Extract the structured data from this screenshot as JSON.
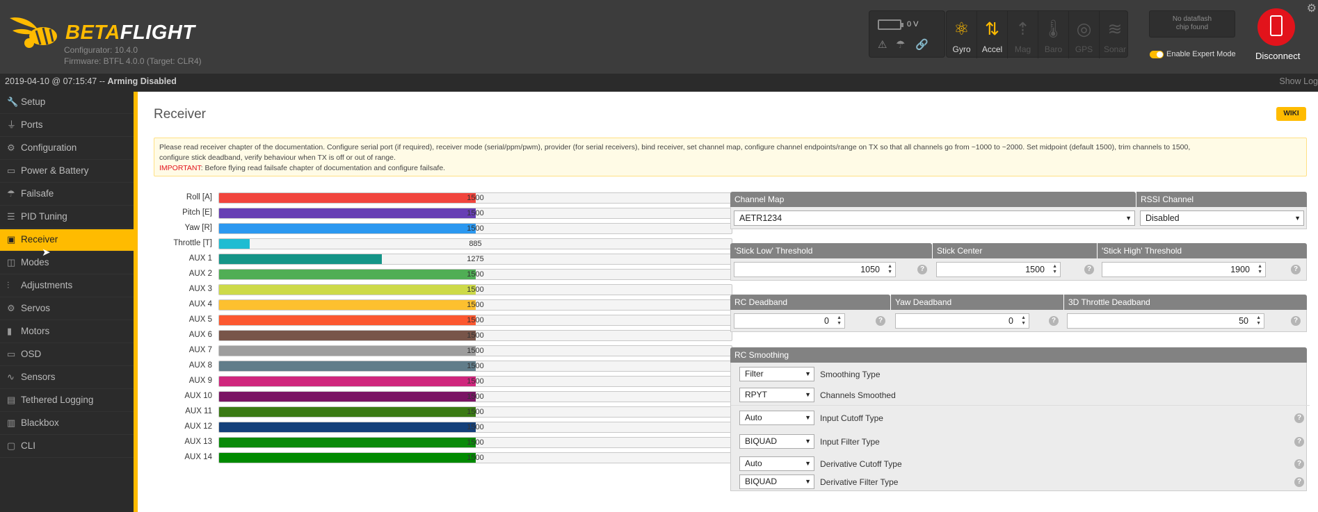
{
  "header": {
    "brand_beta": "BETA",
    "brand_flight": "FLIGHT",
    "configurator_version": "Configurator: 10.4.0",
    "firmware": "Firmware: BTFL 4.0.0 (Target: CLR4)",
    "battery_voltage": "0 V",
    "sensors": [
      {
        "label": "Gyro",
        "icon": "gyro-icon",
        "active": true
      },
      {
        "label": "Accel",
        "icon": "accel-icon",
        "active": true
      },
      {
        "label": "Mag",
        "icon": "mag-icon",
        "active": false
      },
      {
        "label": "Baro",
        "icon": "baro-icon",
        "active": false
      },
      {
        "label": "GPS",
        "icon": "gps-icon",
        "active": false
      },
      {
        "label": "Sonar",
        "icon": "sonar-icon",
        "active": false
      }
    ],
    "dataflash_line1": "No dataflash",
    "dataflash_line2": "chip found",
    "expert_mode_label": "Enable Expert Mode",
    "disconnect_label": "Disconnect"
  },
  "status_bar": {
    "datetime": "2019-04-10 @ 07:15:47 -- ",
    "arming": "Arming Disabled",
    "show_log": "Show Log"
  },
  "sidebar": {
    "items": [
      {
        "label": "Setup",
        "icon": "wrench-icon"
      },
      {
        "label": "Ports",
        "icon": "plug-icon"
      },
      {
        "label": "Configuration",
        "icon": "gear-icon"
      },
      {
        "label": "Power & Battery",
        "icon": "battery-icon"
      },
      {
        "label": "Failsafe",
        "icon": "parachute-icon"
      },
      {
        "label": "PID Tuning",
        "icon": "sliders-icon"
      },
      {
        "label": "Receiver",
        "icon": "receiver-icon",
        "active": true
      },
      {
        "label": "Modes",
        "icon": "modes-icon"
      },
      {
        "label": "Adjustments",
        "icon": "adjustments-icon"
      },
      {
        "label": "Servos",
        "icon": "servo-icon"
      },
      {
        "label": "Motors",
        "icon": "motor-icon"
      },
      {
        "label": "OSD",
        "icon": "osd-icon"
      },
      {
        "label": "Sensors",
        "icon": "sensors-icon"
      },
      {
        "label": "Tethered Logging",
        "icon": "tethered-logging-icon"
      },
      {
        "label": "Blackbox",
        "icon": "blackbox-icon"
      },
      {
        "label": "CLI",
        "icon": "cli-icon"
      }
    ]
  },
  "page": {
    "title": "Receiver",
    "wiki": "WIKI",
    "note_line1": "Please read receiver chapter of the documentation. Configure serial port (if required), receiver mode (serial/ppm/pwm), provider (for serial receivers), bind receiver, set channel map, configure channel endpoints/range on TX so that all channels go from ~1000 to ~2000. Set midpoint (default 1500), trim channels to 1500,",
    "note_line2": "configure stick deadband, verify behaviour when TX is off or out of range.",
    "note_important": "IMPORTANT",
    "note_line3": ": Before flying read failsafe chapter of documentation and configure failsafe."
  },
  "channels": {
    "range": [
      885,
      2115
    ],
    "items": [
      {
        "label": "Roll [A]",
        "value": 1500,
        "color": "#f1453d"
      },
      {
        "label": "Pitch [E]",
        "value": 1500,
        "color": "#673fb4"
      },
      {
        "label": "Yaw [R]",
        "value": 1500,
        "color": "#2b98f0"
      },
      {
        "label": "Throttle [T]",
        "value": 885,
        "color": "#1fbcd2",
        "fill_fraction": 0.06
      },
      {
        "label": "AUX 1",
        "value": 1275,
        "color": "#159588"
      },
      {
        "label": "AUX 2",
        "value": 1500,
        "color": "#50ae55"
      },
      {
        "label": "AUX 3",
        "value": 1500,
        "color": "#cdda49"
      },
      {
        "label": "AUX 4",
        "value": 1500,
        "color": "#fdc02f"
      },
      {
        "label": "AUX 5",
        "value": 1500,
        "color": "#fc5830"
      },
      {
        "label": "AUX 6",
        "value": 1500,
        "color": "#785549"
      },
      {
        "label": "AUX 7",
        "value": 1500,
        "color": "#9e9e9e"
      },
      {
        "label": "AUX 8",
        "value": 1500,
        "color": "#617d8a"
      },
      {
        "label": "AUX 9",
        "value": 1500,
        "color": "#cf267d"
      },
      {
        "label": "AUX 10",
        "value": 1500,
        "color": "#7a1464"
      },
      {
        "label": "AUX 11",
        "value": 1500,
        "color": "#3a7a14"
      },
      {
        "label": "AUX 12",
        "value": 1500,
        "color": "#14407a"
      },
      {
        "label": "AUX 13",
        "value": 1500,
        "color": "#0a8a0a"
      },
      {
        "label": "AUX 14",
        "value": 1500,
        "color": "#008a00"
      }
    ]
  },
  "channel_map": {
    "header": "Channel Map",
    "value": "AETR1234",
    "rssi_header": "RSSI Channel",
    "rssi_value": "Disabled"
  },
  "thresholds": {
    "low_header": "'Stick Low' Threshold",
    "low_value": "1050",
    "center_header": "Stick Center",
    "center_value": "1500",
    "high_header": "'Stick High' Threshold",
    "high_value": "1900"
  },
  "deadband": {
    "rc_header": "RC Deadband",
    "rc_value": "0",
    "yaw_header": "Yaw Deadband",
    "yaw_value": "0",
    "throttle3d_header": "3D Throttle Deadband",
    "throttle3d_value": "50"
  },
  "smoothing": {
    "header": "RC Smoothing",
    "rows": [
      {
        "value": "Filter",
        "label": "Smoothing Type",
        "help": false
      },
      {
        "value": "RPYT",
        "label": "Channels Smoothed",
        "help": false
      },
      {
        "value": "Auto",
        "label": "Input Cutoff Type",
        "help": true
      },
      {
        "value": "BIQUAD",
        "label": "Input Filter Type",
        "help": true
      },
      {
        "value": "Auto",
        "label": "Derivative Cutoff Type",
        "help": true
      },
      {
        "value": "BIQUAD",
        "label": "Derivative Filter Type",
        "help": true
      }
    ]
  }
}
